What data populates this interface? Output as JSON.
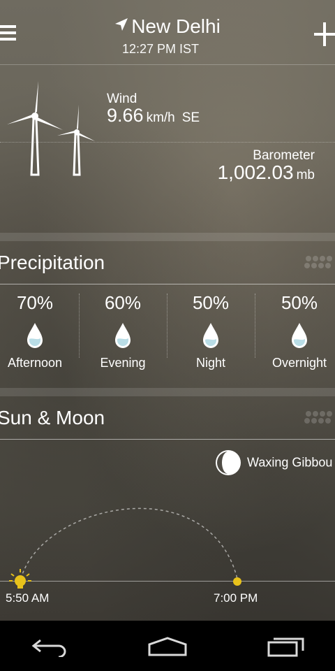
{
  "header": {
    "location": "New Delhi",
    "time": "12:27 PM IST",
    "menu_icon": "hamburger-menu-icon",
    "add_icon": "plus-icon",
    "location_icon": "location-arrow-icon"
  },
  "wind": {
    "title": "Wind",
    "value": "9.66",
    "unit": "km/h",
    "direction": "SE"
  },
  "barometer": {
    "title": "Barometer",
    "value": "1,002.03",
    "unit": "mb"
  },
  "precipitation": {
    "title": "Precipitation",
    "periods": [
      {
        "percent": "70%",
        "label": "Afternoon"
      },
      {
        "percent": "60%",
        "label": "Evening"
      },
      {
        "percent": "50%",
        "label": "Night"
      },
      {
        "percent": "50%",
        "label": "Overnight"
      }
    ]
  },
  "sun_moon": {
    "title": "Sun & Moon",
    "moon_phase": "Waxing Gibbou",
    "sunrise": "5:50 AM",
    "sunset": "7:00 PM"
  },
  "colors": {
    "drop_fill": "#b9dde6",
    "sun_dot": "#e8c21b"
  },
  "navbar": {
    "icons": [
      "back-icon",
      "home-icon",
      "recent-apps-icon"
    ]
  }
}
